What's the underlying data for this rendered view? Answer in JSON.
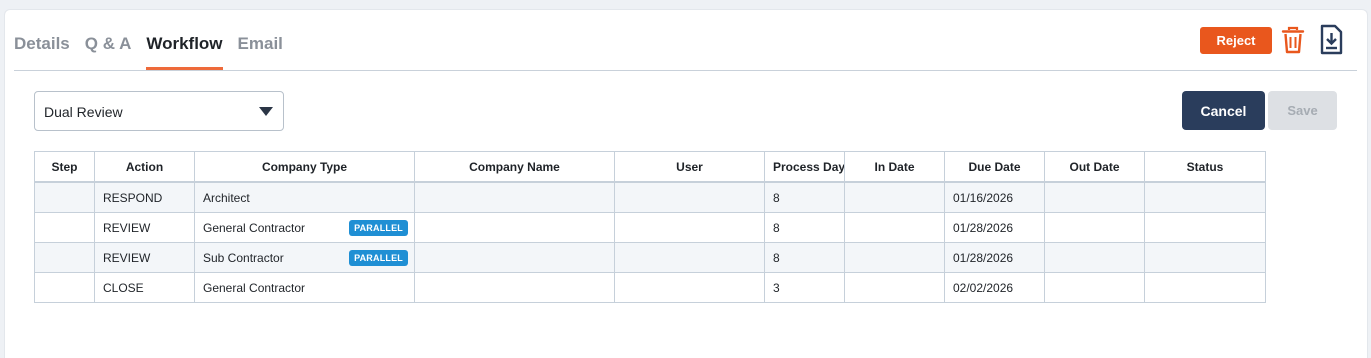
{
  "tabs": [
    {
      "label": "Details",
      "active": false
    },
    {
      "label": "Q & A",
      "active": false
    },
    {
      "label": "Workflow",
      "active": true
    },
    {
      "label": "Email",
      "active": false
    }
  ],
  "actions": {
    "reject_label": "Reject",
    "trash_icon": "trash-icon",
    "download_icon": "download-icon"
  },
  "workflow_select": {
    "value": "Dual Review",
    "icon": "caret-down-icon"
  },
  "buttons": {
    "cancel_label": "Cancel",
    "save_label": "Save"
  },
  "table": {
    "columns": [
      "Step",
      "Action",
      "Company Type",
      "Company Name",
      "User",
      "Process Days",
      "In Date",
      "Due Date",
      "Out Date",
      "Status"
    ],
    "rows": [
      {
        "step": "",
        "action": "RESPOND",
        "company_type": "Architect",
        "badge": "",
        "company_name": "",
        "user": "",
        "process_days": "8",
        "in_date": "",
        "due_date": "01/16/2026",
        "out_date": "",
        "status": ""
      },
      {
        "step": "",
        "action": "REVIEW",
        "company_type": "General Contractor",
        "badge": "PARALLEL",
        "company_name": "",
        "user": "",
        "process_days": "8",
        "in_date": "",
        "due_date": "01/28/2026",
        "out_date": "",
        "status": ""
      },
      {
        "step": "",
        "action": "REVIEW",
        "company_type": "Sub Contractor",
        "badge": "PARALLEL",
        "company_name": "",
        "user": "",
        "process_days": "8",
        "in_date": "",
        "due_date": "01/28/2026",
        "out_date": "",
        "status": ""
      },
      {
        "step": "",
        "action": "CLOSE",
        "company_type": "General Contractor",
        "badge": "",
        "company_name": "",
        "user": "",
        "process_days": "3",
        "in_date": "",
        "due_date": "02/02/2026",
        "out_date": "",
        "status": ""
      }
    ]
  },
  "colors": {
    "accent": "#ee6a3a",
    "reject": "#e9571d",
    "cancel": "#2a3d5c",
    "badge": "#1f8fd4"
  }
}
